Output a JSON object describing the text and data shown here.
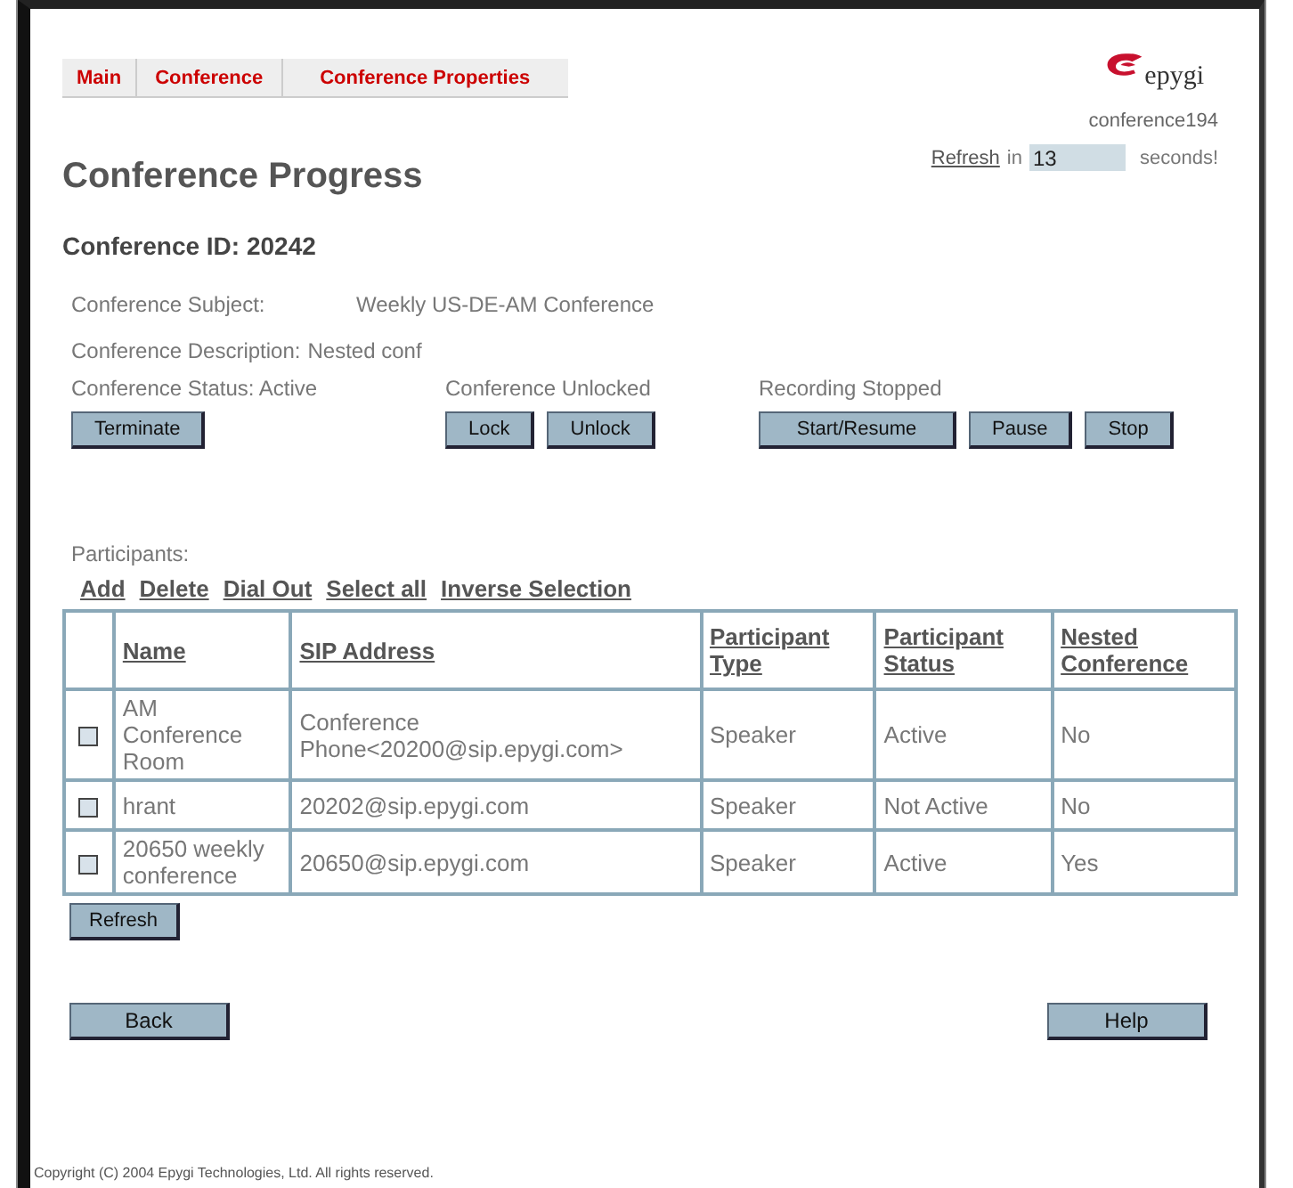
{
  "tabs": [
    {
      "label": "Main"
    },
    {
      "label": "Conference"
    },
    {
      "label": "Conference Properties"
    }
  ],
  "logo": {
    "text": "epygi"
  },
  "account": "conference194",
  "refresh": {
    "link": "Refresh",
    "before": "in",
    "value": "13",
    "after": "seconds!"
  },
  "title": "Conference Progress",
  "conference_id": "Conference ID: 20242",
  "info": [
    {
      "label": "Conference Subject:",
      "value": "Weekly US-DE-AM Conference"
    },
    {
      "label": "Conference Description:",
      "value": "Nested conf"
    }
  ],
  "status_groups": [
    {
      "text": "Conference Status:  Active",
      "buttons": [
        "Terminate"
      ]
    },
    {
      "text": "Conference Unlocked",
      "buttons": [
        "Lock",
        "Unlock"
      ]
    },
    {
      "text": "Recording Stopped",
      "buttons": [
        "Start/Resume",
        "Pause",
        "Stop"
      ]
    }
  ],
  "participants_label": "Participants:",
  "actions": [
    "Add",
    "Delete",
    "Dial Out",
    "Select all",
    "Inverse Selection"
  ],
  "table": {
    "columns": [
      "Name",
      "SIP Address",
      "Participant Type",
      "Participant Status",
      "Nested Conference"
    ],
    "rows": [
      {
        "checked": false,
        "cells": [
          "AM Conference Room",
          "Conference Phone<20200@sip.epygi.com>",
          "Speaker",
          "Active",
          "No"
        ]
      },
      {
        "checked": false,
        "cells": [
          "hrant",
          "20202@sip.epygi.com",
          "Speaker",
          "Not Active",
          "No"
        ]
      },
      {
        "checked": false,
        "cells": [
          "20650 weekly conference",
          "20650@sip.epygi.com",
          "Speaker",
          "Active",
          "Yes"
        ]
      }
    ]
  },
  "refresh_button": "Refresh",
  "back_button": "Back",
  "help_button": "Help",
  "copyright": "Copyright (C) 2004 Epygi Technologies, Ltd. All rights reserved."
}
